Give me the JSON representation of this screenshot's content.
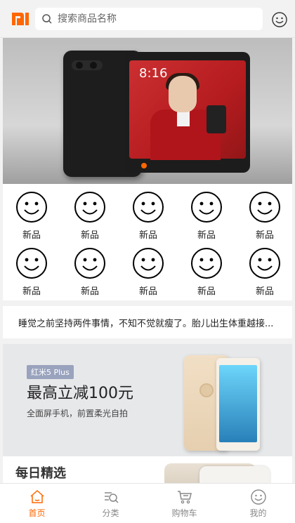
{
  "header": {
    "logo": "mi-logo",
    "search_placeholder": "搜索商品名称",
    "search_icon": "search-icon",
    "profile_icon": "smiley-icon"
  },
  "banner": {
    "screen_time": "8:16",
    "active_dot_color": "#ff6700"
  },
  "categories": [
    {
      "label": "新品",
      "icon": "smiley-icon"
    },
    {
      "label": "新品",
      "icon": "smiley-icon"
    },
    {
      "label": "新品",
      "icon": "smiley-icon"
    },
    {
      "label": "新品",
      "icon": "smiley-icon"
    },
    {
      "label": "新品",
      "icon": "smiley-icon"
    },
    {
      "label": "新品",
      "icon": "smiley-icon"
    },
    {
      "label": "新品",
      "icon": "smiley-icon"
    },
    {
      "label": "新品",
      "icon": "smiley-icon"
    },
    {
      "label": "新品",
      "icon": "smiley-icon"
    },
    {
      "label": "新品",
      "icon": "smiley-icon"
    }
  ],
  "notice": {
    "text": "睡觉之前坚持两件事情，不知不觉就瘦了。胎儿出生体重越接..."
  },
  "promo": {
    "tag": "红米5 Plus",
    "headline": "最高立减100元",
    "sub": "全面屏手机，前置柔光自拍"
  },
  "daily": {
    "title": "每日精选"
  },
  "nav": {
    "items": [
      {
        "label": "首页",
        "icon": "home-icon",
        "active": true
      },
      {
        "label": "分类",
        "icon": "category-icon",
        "active": false
      },
      {
        "label": "购物车",
        "icon": "cart-icon",
        "active": false
      },
      {
        "label": "我的",
        "icon": "smiley-icon",
        "active": false
      }
    ],
    "accent": "#ff6700"
  }
}
